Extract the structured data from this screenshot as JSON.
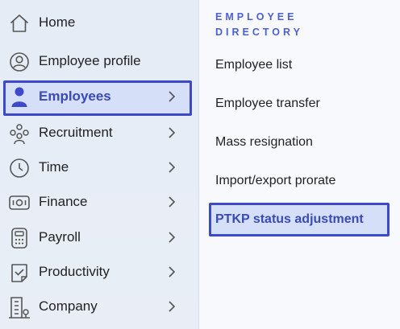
{
  "sidebar": {
    "items": [
      {
        "label": "Home",
        "icon": "home-icon",
        "has_chevron": false
      },
      {
        "label": "Employee profile",
        "icon": "user-circle-icon",
        "has_chevron": false
      },
      {
        "label": "Employees",
        "icon": "person-icon",
        "has_chevron": true,
        "active": true
      },
      {
        "label": "Recruitment",
        "icon": "people-group-icon",
        "has_chevron": true
      },
      {
        "label": "Time",
        "icon": "clock-icon",
        "has_chevron": true
      },
      {
        "label": "Finance",
        "icon": "money-icon",
        "has_chevron": true
      },
      {
        "label": "Payroll",
        "icon": "calculator-icon",
        "has_chevron": true
      },
      {
        "label": "Productivity",
        "icon": "checklist-icon",
        "has_chevron": true
      },
      {
        "label": "Company",
        "icon": "building-icon",
        "has_chevron": true
      }
    ]
  },
  "submenu": {
    "section_title_line1": "EMPLOYEE",
    "section_title_line2": "DIRECTORY",
    "items": [
      {
        "label": "Employee list"
      },
      {
        "label": "Employee transfer"
      },
      {
        "label": "Mass resignation"
      },
      {
        "label": "Import/export prorate"
      },
      {
        "label": "PTKP status adjustment",
        "active": true
      }
    ]
  },
  "colors": {
    "accent": "#3d49c8",
    "active_bg": "#d5dff8",
    "active_text": "#3a4ab6",
    "section_title": "#4d5fd6",
    "sidebar_bg": "#e7edf6",
    "submenu_bg": "#f7f9fc"
  }
}
